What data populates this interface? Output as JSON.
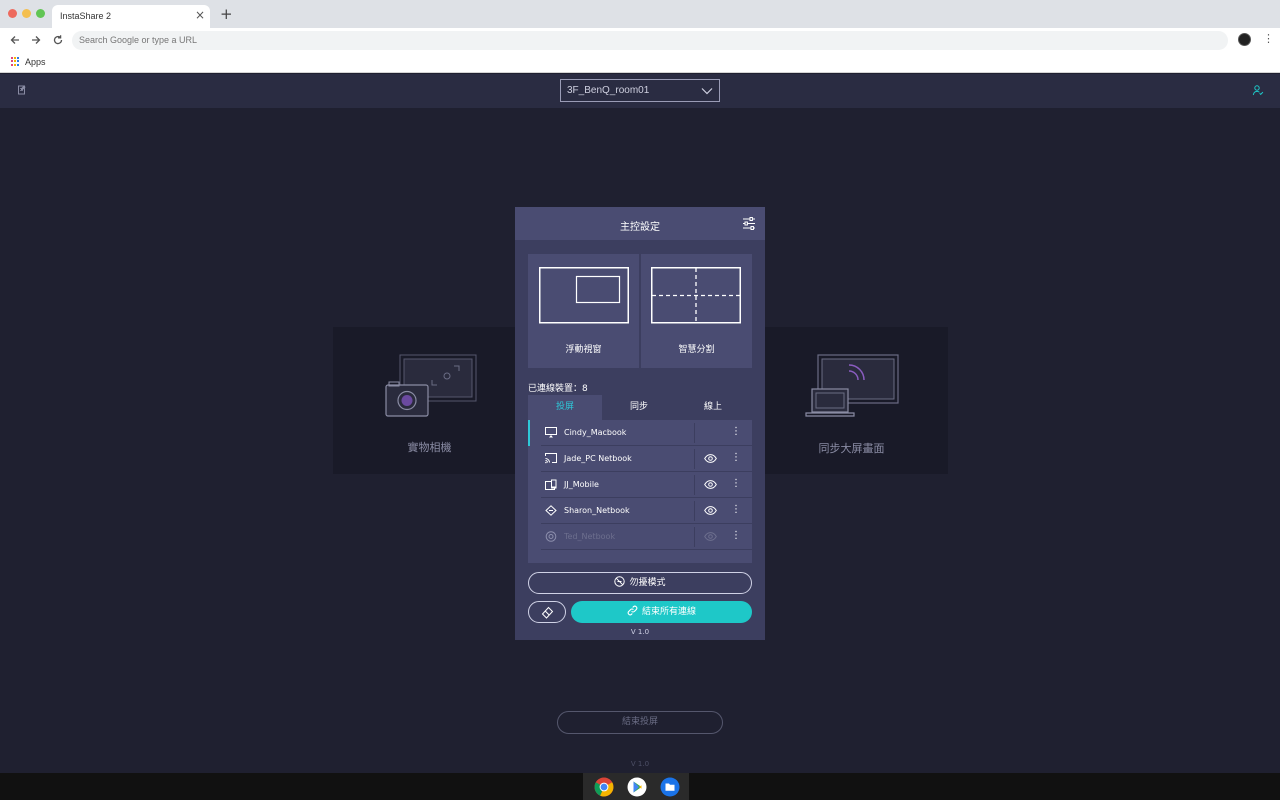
{
  "browser": {
    "tab_title": "InstaShare 2",
    "tab_close": "×",
    "new_tab": "+",
    "omnibox_placeholder": "Search Google or type a URL",
    "bookmark_apps": "Apps",
    "menu": "⋮"
  },
  "header": {
    "room": "3F_BenQ_room01"
  },
  "cards": {
    "left_label": "實物相機",
    "right_label": "同步大屏畫面"
  },
  "panel": {
    "title": "主控設定",
    "layouts": [
      {
        "label": "浮動視窗"
      },
      {
        "label": "智慧分割"
      }
    ],
    "connected_label": "已連線裝置：8",
    "tabs": [
      {
        "label": "投屏",
        "active": true
      },
      {
        "label": "同步",
        "active": false
      },
      {
        "label": "線上",
        "active": false
      }
    ],
    "devices": [
      {
        "name": "Cindy_Macbook",
        "icon": "airplay-icon",
        "eye": false,
        "active": true,
        "dimmed": false,
        "more": "⋮"
      },
      {
        "name": "Jade_PC Netbook",
        "icon": "cast-icon",
        "eye": true,
        "active": false,
        "dimmed": false,
        "more": "⋮"
      },
      {
        "name": "JJ_Mobile",
        "icon": "mobile-icon",
        "eye": true,
        "active": false,
        "dimmed": false,
        "more": "⋮"
      },
      {
        "name": "Sharon_Netbook",
        "icon": "diamond-icon",
        "eye": true,
        "active": false,
        "dimmed": false,
        "more": "⋮"
      },
      {
        "name": "Ted_Netbook",
        "icon": "target-icon",
        "eye": true,
        "active": false,
        "dimmed": true,
        "more": "⋮"
      }
    ],
    "dnd_label": "勿擾模式",
    "end_all_label": "結束所有連線",
    "version": "V 1.0"
  },
  "main": {
    "end_projection": "結束投屏",
    "version": "V 1.0"
  },
  "colors": {
    "accent": "#1ec8c8",
    "panel_bg": "#3c3e5f",
    "panel_header": "#4a4c72",
    "app_bg": "#1f2030"
  }
}
